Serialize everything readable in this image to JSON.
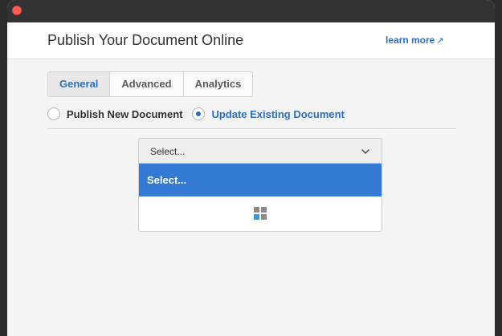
{
  "header": {
    "title": "Publish Your Document Online",
    "learn_more": "learn more",
    "learn_more_icon": "↗"
  },
  "tabs": [
    {
      "label": "General",
      "active": true
    },
    {
      "label": "Advanced",
      "active": false
    },
    {
      "label": "Analytics",
      "active": false
    }
  ],
  "publish_mode": {
    "options": [
      {
        "label": "Publish New Document",
        "checked": false
      },
      {
        "label": "Update Existing Document",
        "checked": true
      }
    ]
  },
  "document_select": {
    "value": "Select...",
    "menu_items": [
      {
        "label": "Select...",
        "selected": true
      }
    ],
    "loading_icon": "grid-loading-icon"
  },
  "colors": {
    "accent": "#2d6fbe",
    "selection": "#3479d3",
    "close_button": "#fe5f57",
    "titlebar": "#323232"
  }
}
